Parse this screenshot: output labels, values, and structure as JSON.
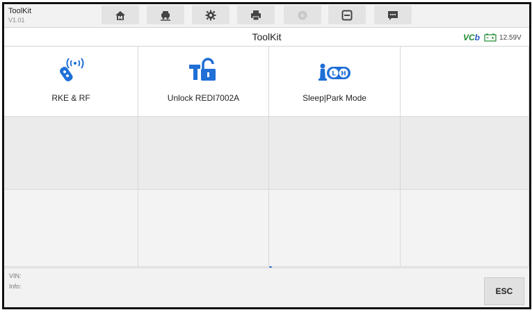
{
  "app": {
    "title": "ToolKit",
    "version": "V1.01"
  },
  "toolbar": {
    "buttons": [
      {
        "icon": "home-icon"
      },
      {
        "icon": "vehicle-swap-icon"
      },
      {
        "icon": "gear-icon"
      },
      {
        "icon": "printer-icon"
      },
      {
        "icon": "help-icon",
        "disabled": true
      },
      {
        "icon": "save-icon"
      },
      {
        "icon": "message-icon"
      }
    ]
  },
  "header": {
    "title": "ToolKit",
    "vci": {
      "v": "VC",
      "b": "b"
    },
    "voltage": "12.59V"
  },
  "tools": [
    {
      "label": "RKE & RF",
      "icon": "rke-rf-icon"
    },
    {
      "label": "Unlock REDI7002A",
      "icon": "unlock-icon"
    },
    {
      "label": "Sleep|Park Mode",
      "icon": "sleep-park-icon"
    }
  ],
  "footer": {
    "vin_label": "VIN:",
    "info_label": "Info:",
    "esc_label": "ESC"
  },
  "colors": {
    "accent_blue": "#1f6fd6",
    "vci_green": "#1c8a2e",
    "icon_dark": "#444444"
  }
}
